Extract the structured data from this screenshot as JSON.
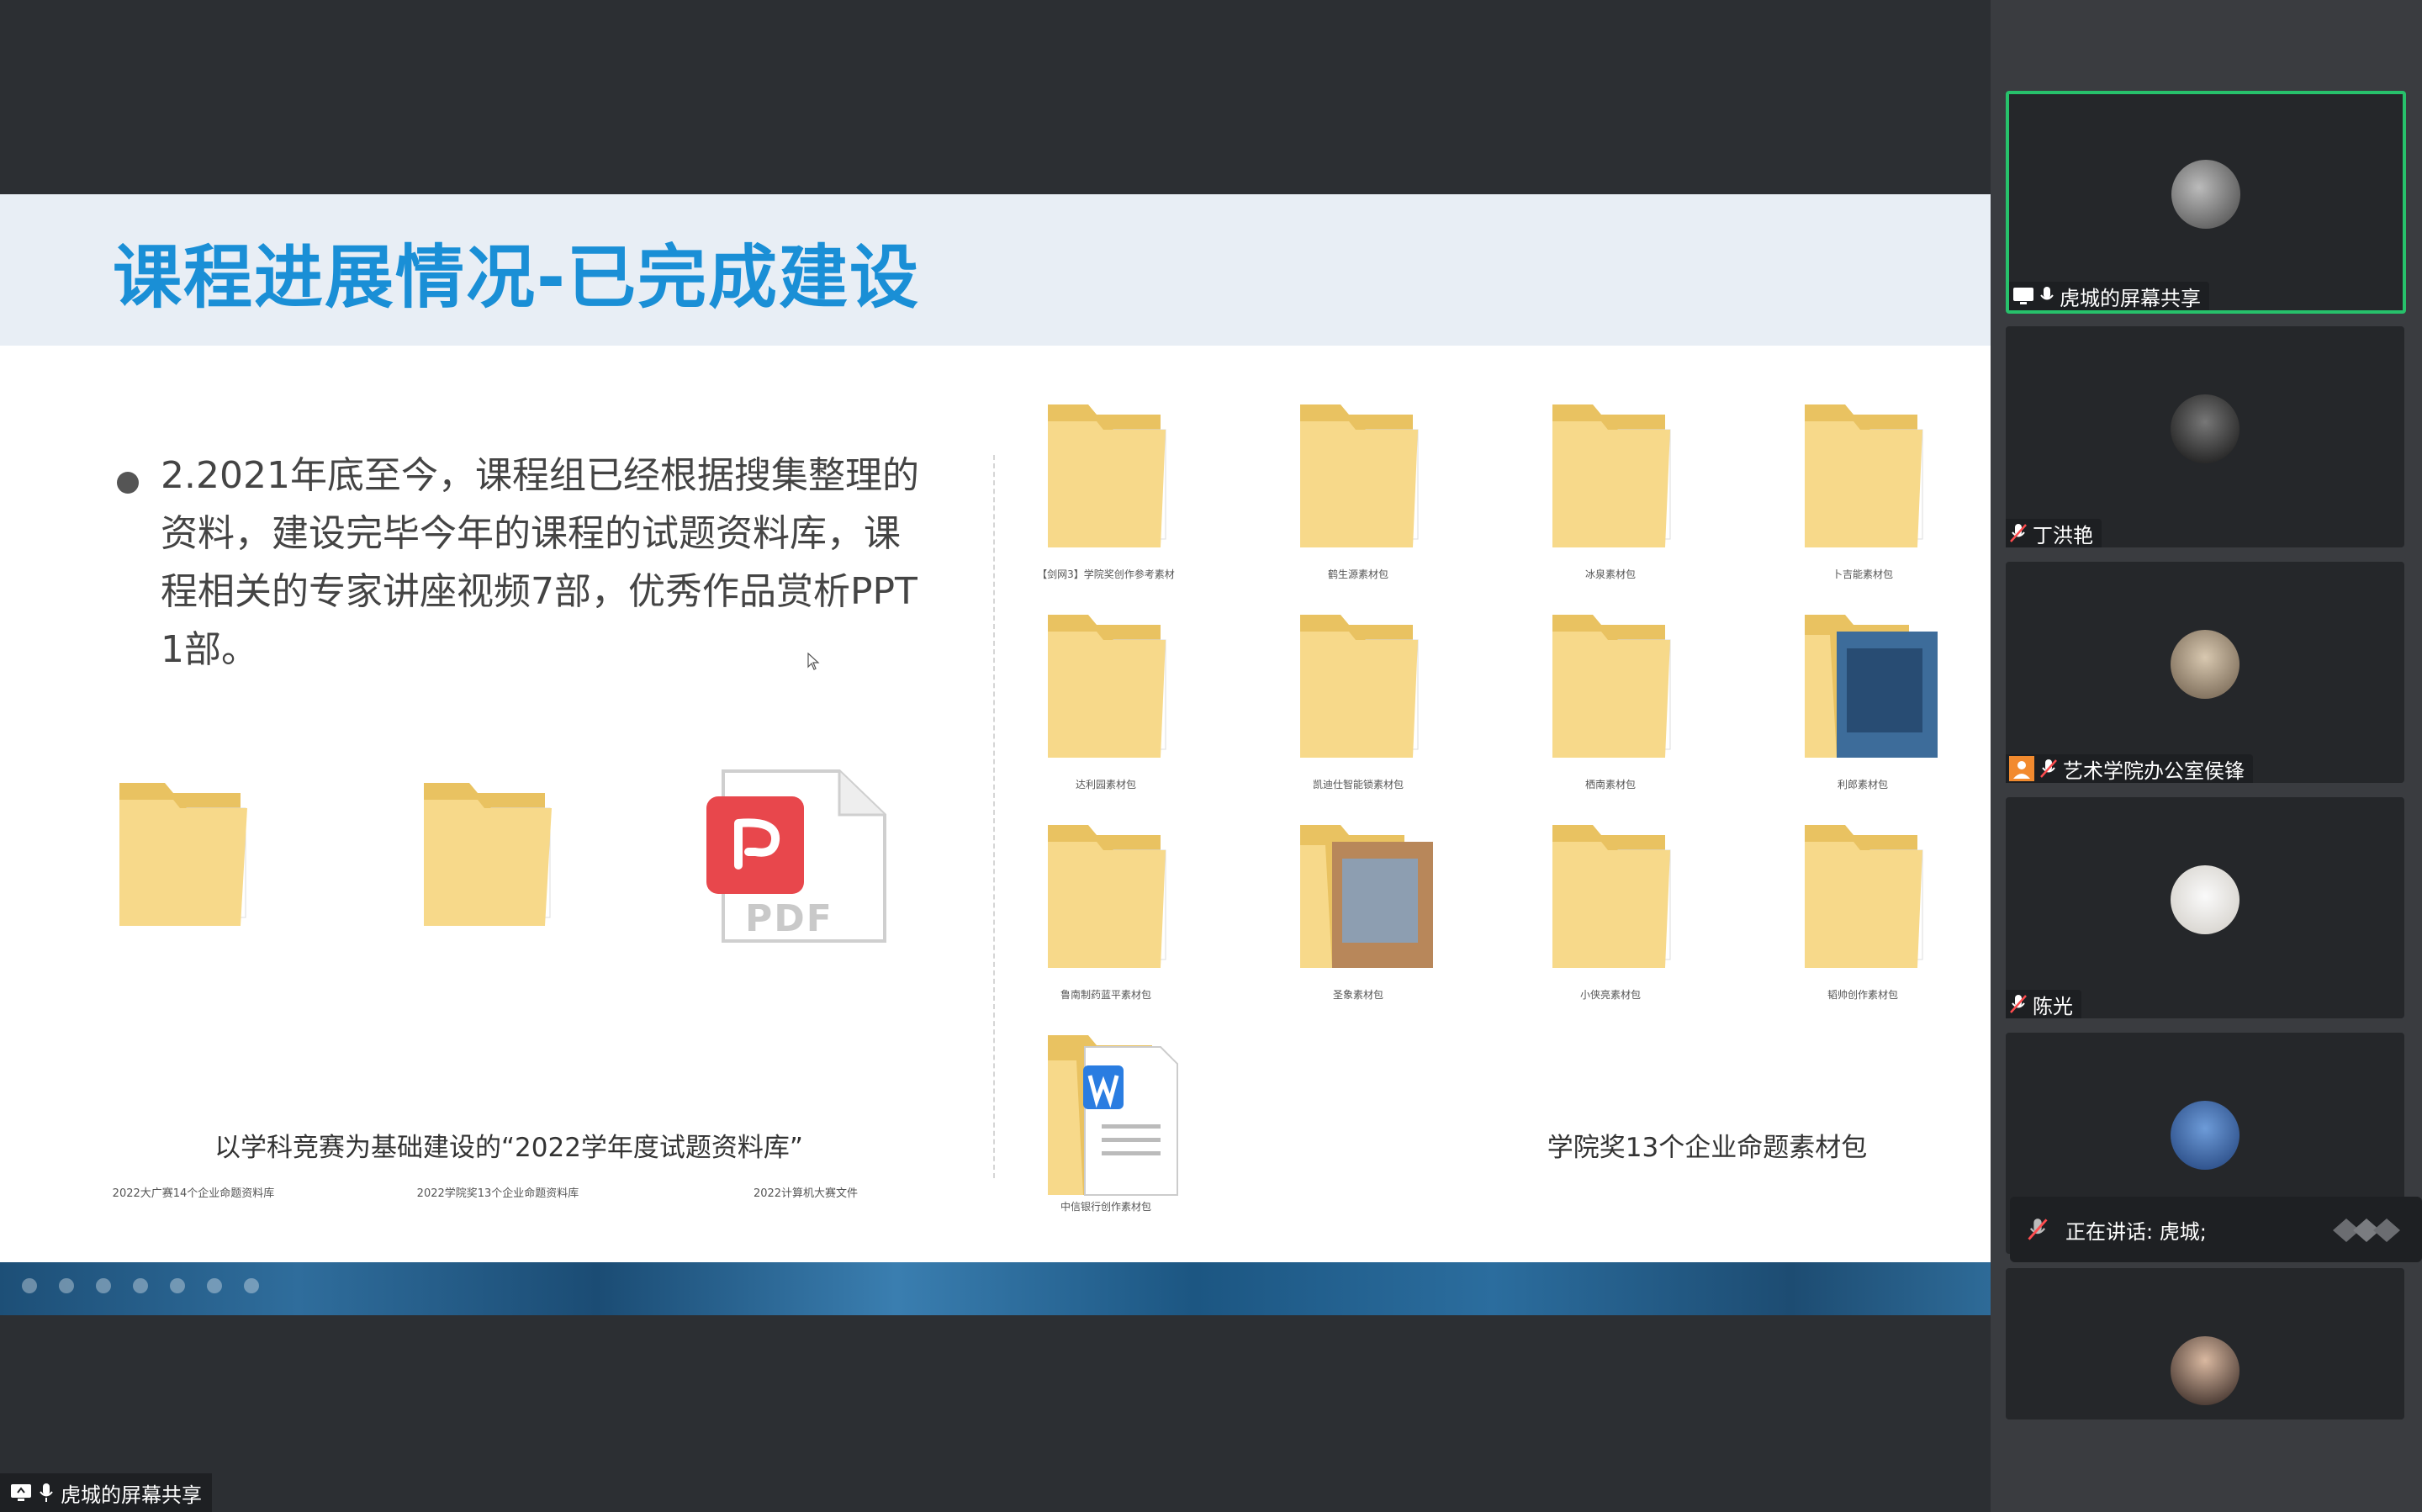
{
  "slide": {
    "title": "课程进展情况-已完成建设",
    "bullet": "2.2021年底至今，课程组已经根据搜集整理的资料，建设完毕今年的课程的试题资料库，课程相关的专家讲座视频7部，优秀作品赏析PPT 1部。",
    "left_items": [
      {
        "label": "2022大广赛14个企业命题资料库",
        "icon": "folder-icon"
      },
      {
        "label": "2022学院奖13个企业命题资料库",
        "icon": "folder-icon"
      },
      {
        "label": "2022计算机大赛文件",
        "icon": "pdf-file-icon",
        "badge": "PDF"
      }
    ],
    "left_caption": "以学科竞赛为基础建设的“2022学年度试题资料库”",
    "right_items": [
      {
        "label": "【剑网3】学院奖创作参考素材",
        "icon": "folder-icon"
      },
      {
        "label": "鹤生源素材包",
        "icon": "folder-icon"
      },
      {
        "label": "冰泉素材包",
        "icon": "folder-icon"
      },
      {
        "label": "卜吉能素材包",
        "icon": "folder-icon"
      },
      {
        "label": "达利园素材包",
        "icon": "folder-icon"
      },
      {
        "label": "凯迪仕智能锁素材包",
        "icon": "folder-icon"
      },
      {
        "label": "栖南素材包",
        "icon": "folder-icon"
      },
      {
        "label": "利郎素材包",
        "icon": "image-folder-icon"
      },
      {
        "label": "鲁南制药蓝平素材包",
        "icon": "folder-icon"
      },
      {
        "label": "圣象素材包",
        "icon": "image-folder-icon"
      },
      {
        "label": "小侠亮素材包",
        "icon": "folder-icon"
      },
      {
        "label": "韬帅创作素材包",
        "icon": "folder-icon"
      },
      {
        "label": "中信银行创作素材包",
        "icon": "word-doc-folder-icon"
      }
    ],
    "right_caption": "学院奖13个企业命题素材包"
  },
  "share_tag": {
    "label": "虎城的屏幕共享",
    "icons": [
      "screen-share-icon",
      "mic-icon"
    ]
  },
  "participants": [
    {
      "name": "虎城的屏幕共享",
      "active": true,
      "icons": [
        "screen-share-icon",
        "mic-icon"
      ],
      "avatar_color": "#6b6b6b"
    },
    {
      "name": "丁洪艳",
      "active": false,
      "icons": [
        "mic-muted-icon"
      ],
      "avatar_color": "#2a2a2a"
    },
    {
      "name": "艺术学院办公室侯锋",
      "active": false,
      "icons": [
        "host-icon",
        "mic-muted-icon"
      ],
      "avatar_color": "#8a7b6a"
    },
    {
      "name": "陈光",
      "active": false,
      "icons": [
        "mic-muted-icon"
      ],
      "avatar_color": "#e8e6e2"
    },
    {
      "name": "",
      "active": false,
      "icons": [],
      "avatar_color": "#3f6fae"
    },
    {
      "name": "",
      "active": false,
      "icons": [],
      "avatar_color": "#4a3a36"
    }
  ],
  "speaking": {
    "text": "正在讲话: 虎城;",
    "icon": "mic-muted-icon"
  },
  "colors": {
    "title_blue": "#1a8fd6",
    "active_border": "#27c16b",
    "pdf_red": "#e8474c",
    "folder_yellow": "#f5d57a"
  }
}
